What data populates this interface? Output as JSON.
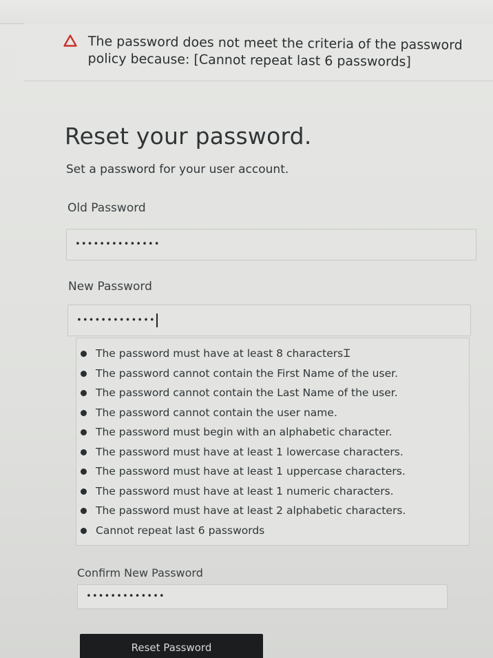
{
  "alert": {
    "icon": "warning-triangle-icon",
    "message": "The password does not meet the criteria of the password policy because: [Cannot repeat last 6 passwords]",
    "color": "#c8332b"
  },
  "form": {
    "title": "Reset your password.",
    "subtitle": "Set a password for your user account.",
    "old_password": {
      "label": "Old Password",
      "masked_value": "••••••••••••••"
    },
    "new_password": {
      "label": "New Password",
      "masked_value": "•••••••••••••"
    },
    "rules": [
      "The password must have at least 8 characters",
      "The password cannot contain the First Name of the user.",
      "The password cannot contain the Last Name of the user.",
      "The password cannot contain the user name.",
      "The password must begin with an alphabetic character.",
      "The password must have at least 1 lowercase characters.",
      "The password must have at least 1 uppercase characters.",
      "The password must have at least 1 numeric characters.",
      "The password must have at least 2 alphabetic characters.",
      "Cannot repeat last 6 passwords"
    ],
    "confirm_password": {
      "label": "Confirm New Password",
      "masked_value": "•••••••••••••"
    },
    "submit_label": "Reset Password"
  }
}
